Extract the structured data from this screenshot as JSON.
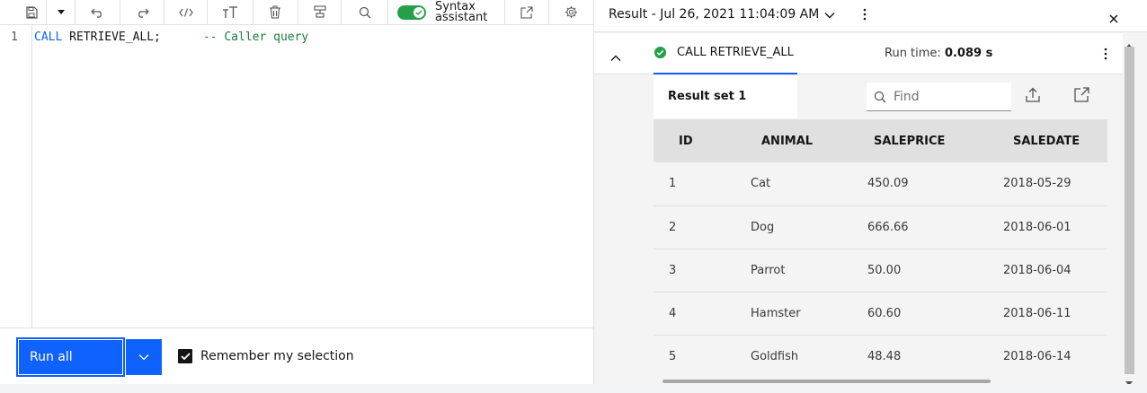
{
  "editor": {
    "toggle_label": "Syntax assistant",
    "line_number": "1",
    "code": {
      "keyword": "CALL",
      "rest": " RETRIEVE_ALL;",
      "comment": "-- Caller query"
    },
    "run_label": "Run all",
    "remember_label": "Remember my selection",
    "remember_checked": true
  },
  "results": {
    "header_title": "Result - Jul 26, 2021 11:04:09 AM",
    "statement": "CALL RETRIEVE_ALL",
    "status": "success",
    "run_time_label": "Run time:",
    "run_time_value": "0.089 s",
    "tab_label": "Result set 1",
    "find_placeholder": "Find",
    "columns": [
      "ID",
      "ANIMAL",
      "SALEPRICE",
      "SALEDATE"
    ],
    "rows": [
      [
        "1",
        "Cat",
        "450.09",
        "2018-05-29"
      ],
      [
        "2",
        "Dog",
        "666.66",
        "2018-06-01"
      ],
      [
        "3",
        "Parrot",
        "50.00",
        "2018-06-04"
      ],
      [
        "4",
        "Hamster",
        "60.60",
        "2018-06-11"
      ],
      [
        "5",
        "Goldfish",
        "48.48",
        "2018-06-14"
      ]
    ]
  },
  "colors": {
    "accent": "#0f62fe",
    "success": "#24a148"
  },
  "icons": [
    "save-icon",
    "caret-down-icon",
    "undo-icon",
    "redo-icon",
    "code-icon",
    "text-size-icon",
    "delete-icon",
    "format-icon",
    "search-icon",
    "popout-icon",
    "settings-icon",
    "chevron-down-icon",
    "overflow-menu-icon",
    "close-icon",
    "chevron-up-icon",
    "checkmark-filled-icon",
    "export-icon",
    "launch-icon"
  ]
}
